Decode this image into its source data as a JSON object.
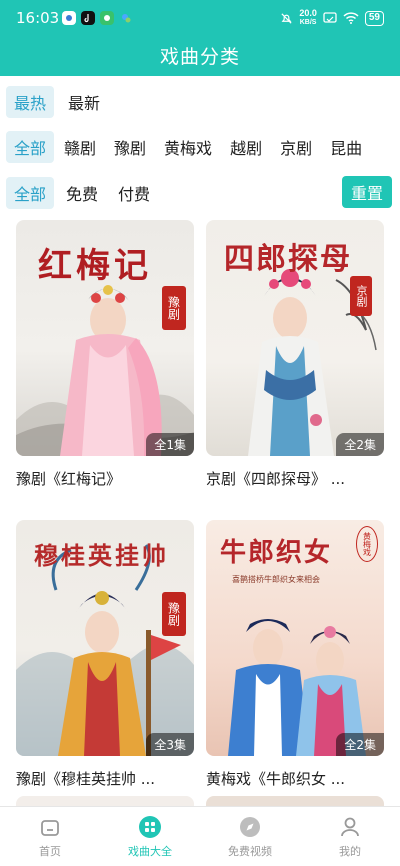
{
  "status": {
    "time": "16:03",
    "net_speed": "20.0",
    "net_unit": "KB/S",
    "battery": "59"
  },
  "header": {
    "title": "戏曲分类"
  },
  "filters": {
    "sort": [
      "最热",
      "最新"
    ],
    "genre": [
      "全部",
      "赣剧",
      "豫剧",
      "黄梅戏",
      "越剧",
      "京剧",
      "昆曲"
    ],
    "price": [
      "全部",
      "免费",
      "付费"
    ],
    "reset": "重置"
  },
  "cards": [
    {
      "poster_title": "红梅记",
      "seal": "豫剧",
      "badge": "全1集",
      "title": "豫剧《红梅记》"
    },
    {
      "poster_title": "四郎探母",
      "seal": "京剧",
      "badge": "全2集",
      "title": "京剧《四郎探母》 ..."
    },
    {
      "poster_title": "穆桂英挂帅",
      "seal": "豫剧",
      "badge": "全3集",
      "title": "豫剧《穆桂英挂帅 ..."
    },
    {
      "poster_title": "牛郎织女",
      "seal": "黄梅戏",
      "subtitle": "喜鹊搭桥牛郎织女来相会",
      "badge": "全2集",
      "title": "黄梅戏《牛郎织女 ..."
    }
  ],
  "tabbar": [
    {
      "label": "首页",
      "icon": "home-icon"
    },
    {
      "label": "戏曲大全",
      "icon": "grid-icon"
    },
    {
      "label": "免费视频",
      "icon": "compass-icon"
    },
    {
      "label": "我的",
      "icon": "user-icon"
    }
  ],
  "colors": {
    "accent": "#20c5b5",
    "active_chip_bg": "#e2f1f6",
    "active_chip_text": "#2aa1c8"
  }
}
